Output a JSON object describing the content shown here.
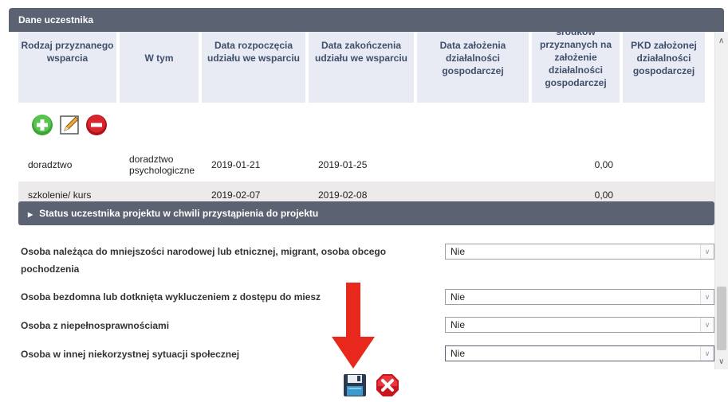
{
  "panel": {
    "title": "Dane uczestnika"
  },
  "table": {
    "headers": [
      "Rodzaj przyznanego wsparcia",
      "W tym",
      "Data rozpoczęcia udziału we wsparciu",
      "Data zakończenia udziału we wsparciu",
      "Data założenia działalności gospodarczej",
      "środków przyznanych na założenie działalności gospodarczej",
      "PKD założonej działalności gospodarczej"
    ],
    "rows": [
      {
        "rodzaj": "doradztwo",
        "wtym": "doradztwo psychologiczne",
        "start": "2019-01-21",
        "end": "2019-01-25",
        "zalozenie": "",
        "kwota": "0,00",
        "pkd": ""
      },
      {
        "rodzaj": "szkolenie/ kurs",
        "wtym": "",
        "start": "2019-02-07",
        "end": "2019-02-08",
        "zalozenie": "",
        "kwota": "0,00",
        "pkd": ""
      }
    ],
    "toolbar": {
      "add_icon": "plus-circle-icon",
      "edit_icon": "pencil-note-icon",
      "remove_icon": "minus-circle-icon"
    }
  },
  "status_section": {
    "title": "Status uczestnika projektu w chwili przystąpienia do projektu"
  },
  "questions": [
    {
      "label": "Osoba należąca do mniejszości narodowej lub etnicznej, migrant, osoba obcego pochodzenia",
      "value": "Nie"
    },
    {
      "label": "Osoba bezdomna lub dotknięta wykluczeniem z dostępu do miesz",
      "value": "Nie"
    },
    {
      "label": "Osoba z niepełnosprawnościami",
      "value": "Nie"
    },
    {
      "label": "Osoba w innej niekorzystnej sytuacji społecznej",
      "value": "Nie"
    }
  ],
  "actions": {
    "save_icon": "floppy-disk-icon",
    "cancel_icon": "red-x-icon"
  },
  "colors": {
    "header_bar": "#5b6372",
    "table_header_bg": "#e8eaf4",
    "alt_row": "#eceaea",
    "arrow": "#e8281c"
  }
}
